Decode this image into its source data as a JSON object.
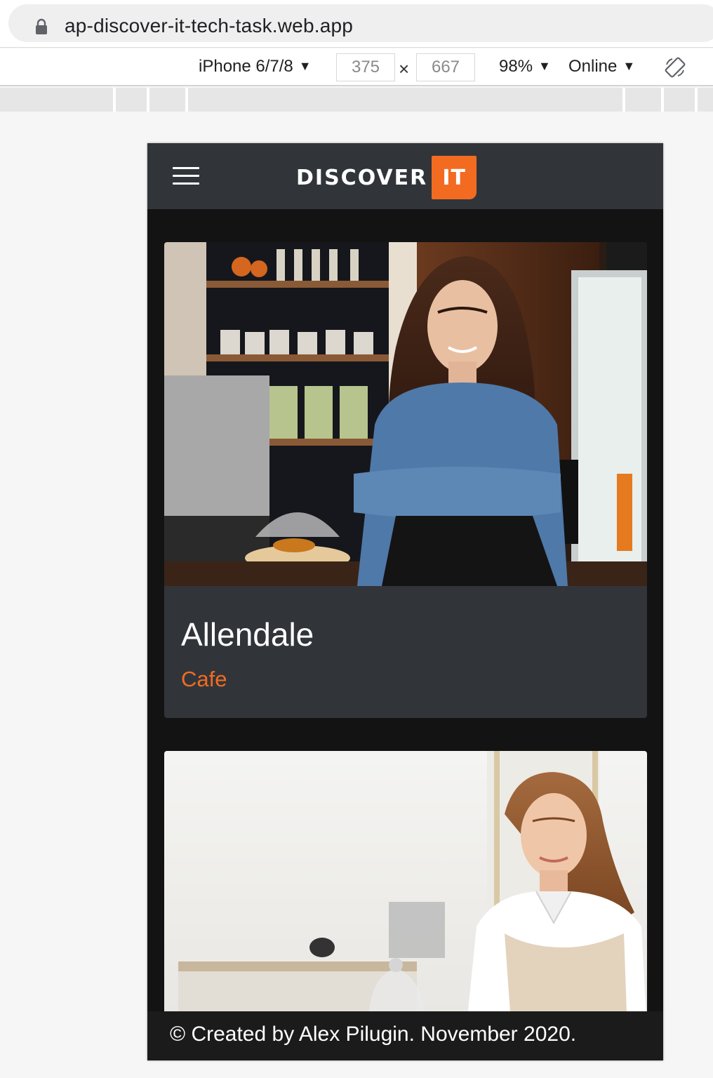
{
  "browser": {
    "url": "ap-discover-it-tech-task.web.app",
    "icons": {
      "lock": "lock-icon",
      "rotate": "rotate-icon"
    }
  },
  "device_toolbar": {
    "device": "iPhone 6/7/8",
    "width": "375",
    "height": "667",
    "times": "×",
    "zoom": "98%",
    "network": "Online",
    "caret": "▼"
  },
  "app": {
    "header": {
      "logo_word": "DISCOVER",
      "logo_accent": "IT"
    },
    "colors": {
      "accent": "#f26b21",
      "header_bg": "#31353a",
      "page_bg": "#131313"
    },
    "cards": [
      {
        "title": "Allendale",
        "category": "Cafe"
      },
      {
        "title": "",
        "category": ""
      }
    ],
    "footer": "© Created by Alex Pilugin. November 2020."
  }
}
